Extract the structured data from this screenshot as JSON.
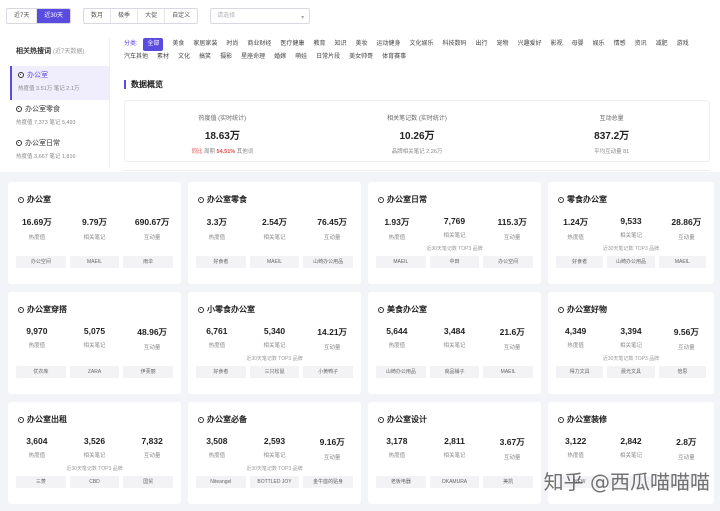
{
  "range": {
    "opt1": "近7天",
    "opt2": "近30天"
  },
  "tabs": [
    "数月",
    "极季",
    "大促",
    "自定义"
  ],
  "select": {
    "placeholder": "请选择",
    "chevron": "chevron-down-icon"
  },
  "hot": {
    "title": "相关热搜词",
    "subtitle": "(近7天数据)",
    "items": [
      {
        "name": "办公室",
        "meta": "热度值  3.51万  笔记  2.1万"
      },
      {
        "name": "办公室零食",
        "meta": "热度值  7,373  笔记  5,493"
      },
      {
        "name": "办公室日常",
        "meta": "热度值  3,667  笔记  1,816"
      }
    ]
  },
  "categories": {
    "label": "分类:",
    "items": [
      "全部",
      "美食",
      "家居家装",
      "时尚",
      "商业财经",
      "医疗健康",
      "教育",
      "知识",
      "美妆",
      "运动健身",
      "文化娱乐",
      "科技数码",
      "出行",
      "宠物",
      "兴趣爱好",
      "影视",
      "母婴",
      "娱乐",
      "情感",
      "资讯",
      "减肥",
      "游戏",
      "汽车其他",
      "素材",
      "文化",
      "搞笑",
      "摄影",
      "星座命理",
      "婚嫁",
      "萌娃",
      "日常片段",
      "美女帅哥",
      "体育赛事"
    ]
  },
  "overview": {
    "title": "数据概览",
    "cols": [
      {
        "t": "热度值 (实时统计)",
        "v": "18.63万",
        "s_pre": "同比",
        "s_lbl": "周期",
        "s_val": "54.51%",
        "s_post": "其他词"
      },
      {
        "t": "相关笔记数 (实时统计)",
        "v": "10.26万",
        "s": "品牌相关笔记 2.26万"
      },
      {
        "t": "互动总量",
        "v": "837.2万",
        "s": "平均互动量 81"
      }
    ]
  },
  "labels": {
    "heat": "热度值",
    "notes": "相关笔记",
    "inter": "互动量"
  },
  "cards": [
    {
      "title": "办公室",
      "a": "16.69万",
      "b": "9.79万",
      "c": "690.67万",
      "note": "",
      "tags": [
        "办公空间",
        "MAEIL",
        "雨伞"
      ]
    },
    {
      "title": "办公室零食",
      "a": "3.3万",
      "b": "2.54万",
      "c": "76.45万",
      "note": "",
      "tags": [
        "好食者",
        "MAEIL",
        "山崎办公用品"
      ]
    },
    {
      "title": "办公室日常",
      "a": "1.93万",
      "b": "7,769",
      "c": "115.3万",
      "note": "近30天笔记数 TOP3 品牌",
      "tags": [
        "MAEIL",
        "中田",
        "办公空间"
      ]
    },
    {
      "title": "零食办公室",
      "a": "1.24万",
      "b": "9,533",
      "c": "28.86万",
      "note": "近30天笔记数 TOP3 品牌",
      "tags": [
        "好食者",
        "山崎办公用品",
        "MAEIL"
      ]
    },
    {
      "title": "办公室穿搭",
      "a": "9,970",
      "b": "5,075",
      "c": "48.96万",
      "note": "",
      "tags": [
        "优衣库",
        "ZARA",
        "伊芙丽"
      ]
    },
    {
      "title": "小零食办公室",
      "a": "6,761",
      "b": "5,340",
      "c": "14.21万",
      "note": "近30天笔记数 TOP3 品牌",
      "tags": [
        "好食者",
        "三只松鼠",
        "小黄鸭子"
      ]
    },
    {
      "title": "美食办公室",
      "a": "5,644",
      "b": "3,484",
      "c": "21.6万",
      "note": "",
      "tags": [
        "山崎办公用品",
        "良品铺子",
        "MAEIL"
      ]
    },
    {
      "title": "办公室好物",
      "a": "4,349",
      "b": "3,394",
      "c": "9.56万",
      "note": "近30天笔记数 TOP3 品牌",
      "tags": [
        "得力文具",
        "晨光文具",
        "倍思"
      ]
    },
    {
      "title": "办公室出租",
      "a": "3,604",
      "b": "3,526",
      "c": "7,832",
      "note": "近30天笔记数 TOP3 品牌",
      "tags": [
        "三菱",
        "CBD",
        "国贸"
      ]
    },
    {
      "title": "办公室必备",
      "a": "3,508",
      "b": "2,593",
      "c": "9.16万",
      "note": "近30天笔记数 TOP3 品牌",
      "tags": [
        "Niteangel",
        "BOTTLED JOY",
        "金牛座的贴身"
      ]
    },
    {
      "title": "办公室设计",
      "a": "3,178",
      "b": "2,811",
      "c": "3.67万",
      "note": "",
      "tags": [
        "老板电器",
        "OKAMURA",
        "美凯"
      ]
    },
    {
      "title": "办公室装修",
      "a": "3,122",
      "b": "2,842",
      "c": "2.8万",
      "note": "",
      "tags": [
        "NEW",
        "",
        ""
      ]
    }
  ],
  "watermark": "知乎 @西瓜喵喵喵"
}
